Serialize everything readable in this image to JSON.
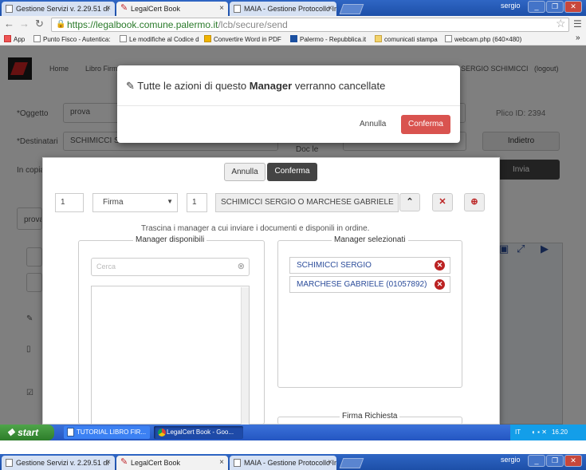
{
  "browser": {
    "tabs": [
      {
        "label": "Gestione Servizi v. 2.29.51 di"
      },
      {
        "label": "LegalCert Book"
      },
      {
        "label": "MAIA - Gestione Protocollo In"
      }
    ],
    "user": "sergio",
    "url_host": "https://legalbook.comune.palermo.it",
    "url_path": "/lcb/secure/send",
    "bookmarks": [
      "App",
      "Punto Fisco - Autentica:",
      "Le modifiche al Codice d",
      "Convertire Word in PDF",
      "Palermo - Repubblica.it",
      "comunicati stampa",
      "webcam.php (640×480)"
    ]
  },
  "app": {
    "nav": [
      "Home",
      "Libro Firma"
    ],
    "username": "SERGIO SCHIMICCI",
    "logout": "(logout)",
    "form": {
      "oggetto_label": "*Oggetto",
      "oggetto_value": "prova",
      "destinatari_label": "*Destinatari",
      "destinatari_value": "SCHIMICCI S",
      "copia_label": "In copia",
      "doc_label": "Doc le",
      "plico_id": "Plico ID: 2394",
      "indietro": "Indietro",
      "invia": "Invia",
      "tab_label": "prova"
    },
    "panel": {
      "annulla": "Annulla",
      "conferma": "Conferma",
      "order_num": "1",
      "action_select": "Firma",
      "step_num": "1",
      "step_value": "SCHIMICCI SERGIO O MARCHESE GABRIELE",
      "instruction": "Trascina i manager a cui inviare i documenti e disponili in ordine.",
      "available_legend": "Manager disponibili",
      "search_placeholder": "Cerca",
      "selected_legend": "Manager selezionati",
      "selected": [
        "SCHIMICCI SERGIO",
        "MARCHESE GABRIELE (01057892)"
      ],
      "firma_richiesta": "Firma Richiesta"
    }
  },
  "modal": {
    "title_pre": "Tutte le azioni di questo",
    "title_bold": "Manager",
    "title_post": "verranno cancellate",
    "cancel": "Annulla",
    "confirm": "Conferma"
  },
  "taskbar": {
    "start": "start",
    "tasks": [
      "TUTORIAL LIBRO FIR...",
      "LegalCert Book - Goo..."
    ],
    "lang": "IT",
    "clock": "16.20"
  },
  "colors": {
    "confirm": "#d9534f",
    "taskbar": "#2456c2",
    "start": "#3e9639"
  }
}
